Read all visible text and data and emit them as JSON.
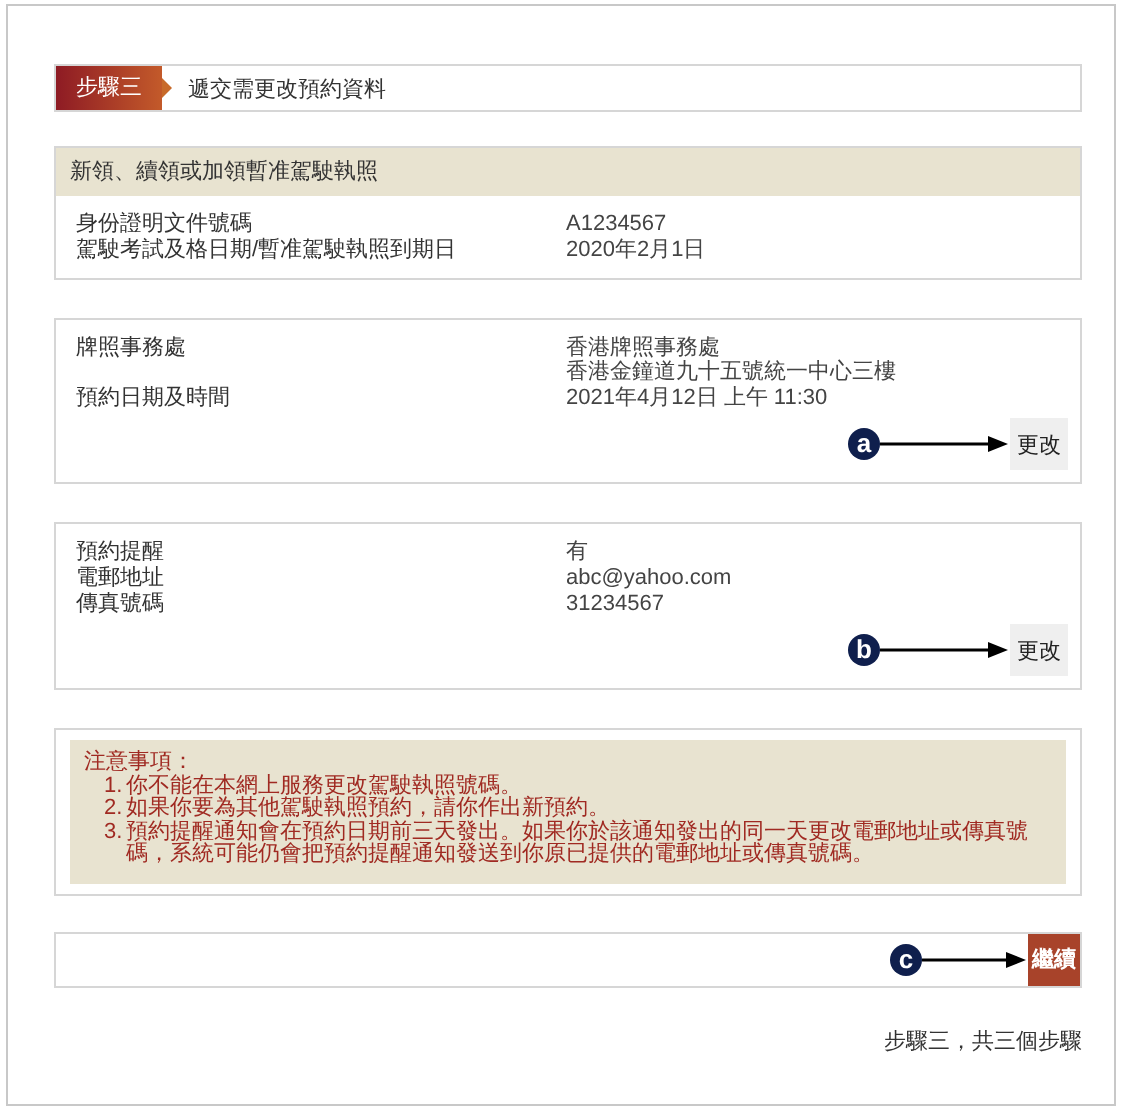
{
  "step": {
    "badge": "步驟三",
    "title": "遞交需更改預約資料"
  },
  "sections": [
    {
      "header": "新領、續領或加領暫准駕駛執照",
      "rows": [
        {
          "label": "身份證明文件號碼",
          "values": [
            "A1234567"
          ]
        },
        {
          "label": "駕駛考試及格日期/暫准駕駛執照到期日",
          "values": [
            "2020年2月1日"
          ]
        }
      ]
    },
    {
      "rows": [
        {
          "label": "牌照事務處",
          "values": [
            "香港牌照事務處",
            "香港金鐘道九十五號統一中心三樓"
          ]
        },
        {
          "label": "預約日期及時間",
          "values": [
            "2021年4月12日 上午 11:30"
          ]
        }
      ],
      "button": "更改",
      "callout": "a"
    },
    {
      "rows": [
        {
          "label": "預約提醒",
          "values": [
            "有"
          ]
        },
        {
          "label": "電郵地址",
          "values": [
            "abc@yahoo.com"
          ]
        },
        {
          "label": "傳真號碼",
          "values": [
            "31234567"
          ]
        }
      ],
      "button": "更改",
      "callout": "b"
    }
  ],
  "notes": {
    "title": "注意事項：",
    "items": [
      {
        "num": "1.",
        "text": "你不能在本網上服務更改駕駛執照號碼。"
      },
      {
        "num": "2.",
        "text": "如果你要為其他駕駛執照預約，請你作出新預約。"
      },
      {
        "num": "3.",
        "text": "預約提醒通知會在預約日期前三天發出。如果你於該通知發出的同一天更改電郵地址或傳真號碼，系統可能仍會把預約提醒通知發送到你原已提供的電郵地址或傳真號碼。"
      }
    ]
  },
  "continue": {
    "button": "繼續",
    "callout": "c"
  },
  "footer": "步驟三，共三個步驟"
}
